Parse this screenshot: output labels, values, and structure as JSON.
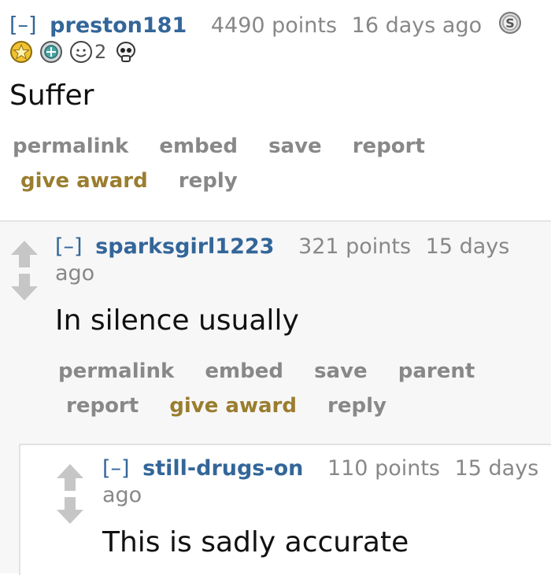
{
  "comment_1": {
    "toggle": "[–]",
    "author": "preston181",
    "score": "4490 points",
    "age": "16 days ago",
    "award_icons": [
      "silver-award-icon",
      "gold-star-award-icon",
      "helpful-award-icon",
      "wholesome-award-icon",
      "skull-award-icon"
    ],
    "award_count": "2",
    "body": "Suffer",
    "buttons": {
      "permalink": "permalink",
      "embed": "embed",
      "save": "save",
      "report": "report",
      "give_award": "give award",
      "reply": "reply"
    }
  },
  "comment_2": {
    "toggle": "[–]",
    "author": "sparksgirl1223",
    "score": "321 points",
    "age_line1": "15 days",
    "age_line2": "ago",
    "body": "In silence usually",
    "buttons": {
      "permalink": "permalink",
      "embed": "embed",
      "save": "save",
      "parent": "parent",
      "report": "report",
      "give_award": "give award",
      "reply": "reply"
    }
  },
  "comment_3": {
    "toggle": "[–]",
    "author": "still-drugs-on",
    "score": "110 points",
    "age_line1": "15 days",
    "age_line2": "ago",
    "body": "This is sadly accurate"
  },
  "colors": {
    "author": "#336699",
    "meta": "#888888",
    "gold": "#9a7d2e",
    "vote_arrow": "#c6c6c6",
    "nested_bg": "#f7f7f8"
  }
}
